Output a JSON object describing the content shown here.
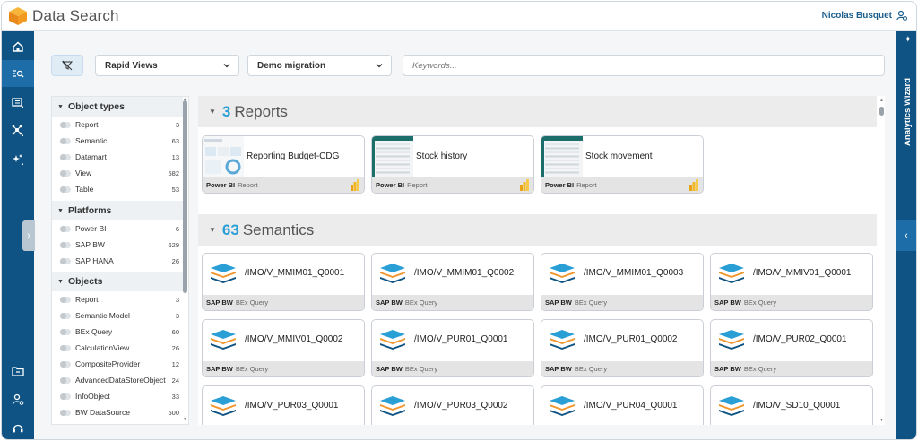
{
  "app": {
    "title": "Data Search",
    "user": "Nicolas Busquet"
  },
  "colors": {
    "nav": "#0e5383",
    "accent": "#2a9fd6",
    "card_footer": "#e4e4e4"
  },
  "filters": {
    "rapid_views": "Rapid Views",
    "migration": "Demo migration",
    "search_placeholder": "Keywords..."
  },
  "wizard": {
    "label": "Analytics Wizard"
  },
  "facets": {
    "object_types": {
      "title": "Object types",
      "items": [
        {
          "label": "Report",
          "count": "3"
        },
        {
          "label": "Semantic",
          "count": "63"
        },
        {
          "label": "Datamart",
          "count": "13"
        },
        {
          "label": "View",
          "count": "582"
        },
        {
          "label": "Table",
          "count": "53"
        }
      ]
    },
    "platforms": {
      "title": "Platforms",
      "items": [
        {
          "label": "Power BI",
          "count": "6"
        },
        {
          "label": "SAP BW",
          "count": "629"
        },
        {
          "label": "SAP HANA",
          "count": "26"
        }
      ]
    },
    "objects": {
      "title": "Objects",
      "items": [
        {
          "label": "Report",
          "count": "3"
        },
        {
          "label": "Semantic Model",
          "count": "3"
        },
        {
          "label": "BEx Query",
          "count": "60"
        },
        {
          "label": "CalculationView",
          "count": "26"
        },
        {
          "label": "CompositeProvider",
          "count": "12"
        },
        {
          "label": "AdvancedDataStoreObject",
          "count": "24"
        },
        {
          "label": "InfoObject",
          "count": "33"
        },
        {
          "label": "BW DataSource",
          "count": "500"
        }
      ]
    }
  },
  "reports": {
    "count": "3",
    "label": "Reports",
    "items": [
      {
        "title": "Reporting Budget-CDG",
        "source": "Power BI",
        "kind": "Report"
      },
      {
        "title": "Stock history",
        "source": "Power BI",
        "kind": "Report"
      },
      {
        "title": "Stock movement",
        "source": "Power BI",
        "kind": "Report"
      }
    ]
  },
  "semantics": {
    "count": "63",
    "label": "Semantics",
    "items": [
      {
        "title": "/IMO/V_MMIM01_Q0001",
        "source": "SAP BW",
        "kind": "BEx Query"
      },
      {
        "title": "/IMO/V_MMIM01_Q0002",
        "source": "SAP BW",
        "kind": "BEx Query"
      },
      {
        "title": "/IMO/V_MMIM01_Q0003",
        "source": "SAP BW",
        "kind": "BEx Query"
      },
      {
        "title": "/IMO/V_MMIV01_Q0001",
        "source": "SAP BW",
        "kind": "BEx Query"
      },
      {
        "title": "/IMO/V_MMIV01_Q0002",
        "source": "SAP BW",
        "kind": "BEx Query"
      },
      {
        "title": "/IMO/V_PUR01_Q0001",
        "source": "SAP BW",
        "kind": "BEx Query"
      },
      {
        "title": "/IMO/V_PUR01_Q0002",
        "source": "SAP BW",
        "kind": "BEx Query"
      },
      {
        "title": "/IMO/V_PUR02_Q0001",
        "source": "SAP BW",
        "kind": "BEx Query"
      },
      {
        "title": "/IMO/V_PUR03_Q0001",
        "source": "SAP BW",
        "kind": "BEx Query"
      },
      {
        "title": "/IMO/V_PUR03_Q0002",
        "source": "SAP BW",
        "kind": "BEx Query"
      },
      {
        "title": "/IMO/V_PUR04_Q0001",
        "source": "SAP BW",
        "kind": "BEx Query"
      },
      {
        "title": "/IMO/V_SD10_Q0001",
        "source": "SAP BW",
        "kind": "BEx Query"
      }
    ]
  }
}
